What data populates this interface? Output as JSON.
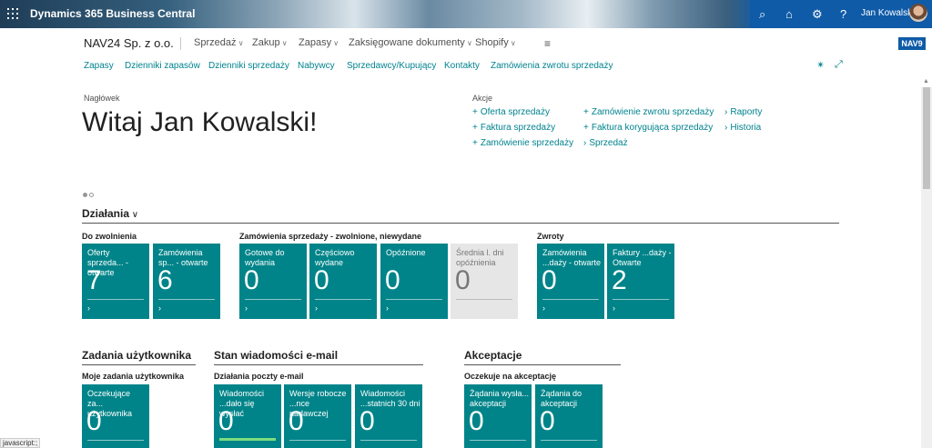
{
  "appbar": {
    "product": "Dynamics 365 Business Central",
    "user_name": "Jan Kowalski",
    "colors": {
      "bar": "#0f5ba8"
    }
  },
  "company": {
    "name": "NAV24 Sp. z o.o.",
    "env_badge": "NAV9"
  },
  "topnav": [
    "Sprzedaż",
    "Zakup",
    "Zapasy",
    "Zaksięgowane dokumenty",
    "Shopify"
  ],
  "subnav": [
    "Zapasy",
    "Dzienniki zapasów",
    "Dzienniki sprzedaży",
    "Nabywcy",
    "Sprzedawcy/Kupujący",
    "Kontakty",
    "Zamówienia zwrotu sprzedaży"
  ],
  "headline": {
    "caption": "Nagłówek",
    "text": "Witaj Jan Kowalski!"
  },
  "actions": {
    "caption": "Akcje",
    "col1": [
      "Oferta sprzedaży",
      "Faktura sprzedaży",
      "Zamówienie sprzedaży"
    ],
    "col2": [
      "Zamówienie zwrotu sprzedaży",
      "Faktura korygująca sprzedaży",
      "Sprzedaż"
    ],
    "col3": [
      "Raporty",
      "Historia"
    ]
  },
  "activities": {
    "title": "Działania",
    "groups": [
      {
        "title": "Do zwolnienia"
      },
      {
        "title": "Zamówienia sprzedaży - zwolnione, niewydane"
      },
      {
        "title": "Zwroty"
      }
    ],
    "tiles": [
      {
        "label": "Oferty sprzeda... - otwarte",
        "value": "7"
      },
      {
        "label": "Zamówienia sp... - otwarte",
        "value": "6"
      },
      {
        "label": "Gotowe do wydania",
        "value": "0"
      },
      {
        "label": "Częściowo wydane",
        "value": "0"
      },
      {
        "label": "Opóźnione",
        "value": "0"
      },
      {
        "label": "Średnia l. dni opóźnienia",
        "value": "0"
      },
      {
        "label": "Zamówienia ...daży - otwarte",
        "value": "0"
      },
      {
        "label": "Faktury ...daży - Otwarte",
        "value": "2"
      }
    ]
  },
  "parts": [
    {
      "title": "Zadania użytkownika",
      "group": "Moje zadania użytkownika",
      "tiles": [
        {
          "label": "Oczekujące za... użytkownika",
          "value": "0"
        }
      ]
    },
    {
      "title": "Stan wiadomości e-mail",
      "group": "Działania poczty e-mail",
      "tiles": [
        {
          "label": "Wiadomości ...dało się wysłać",
          "value": "0",
          "progress": 1.0
        },
        {
          "label": "Wersje robocze ...nce nadawczej",
          "value": "0"
        },
        {
          "label": "Wiadomości ...statnich 30 dni",
          "value": "0"
        }
      ]
    },
    {
      "title": "Akceptacje",
      "group": "Oczekuje na akceptację",
      "tiles": [
        {
          "label": "Żądania wysła... akceptacji",
          "value": "0"
        },
        {
          "label": "Żądania do akceptacji",
          "value": "0"
        }
      ]
    }
  ],
  "statusbar": "javascript:;"
}
